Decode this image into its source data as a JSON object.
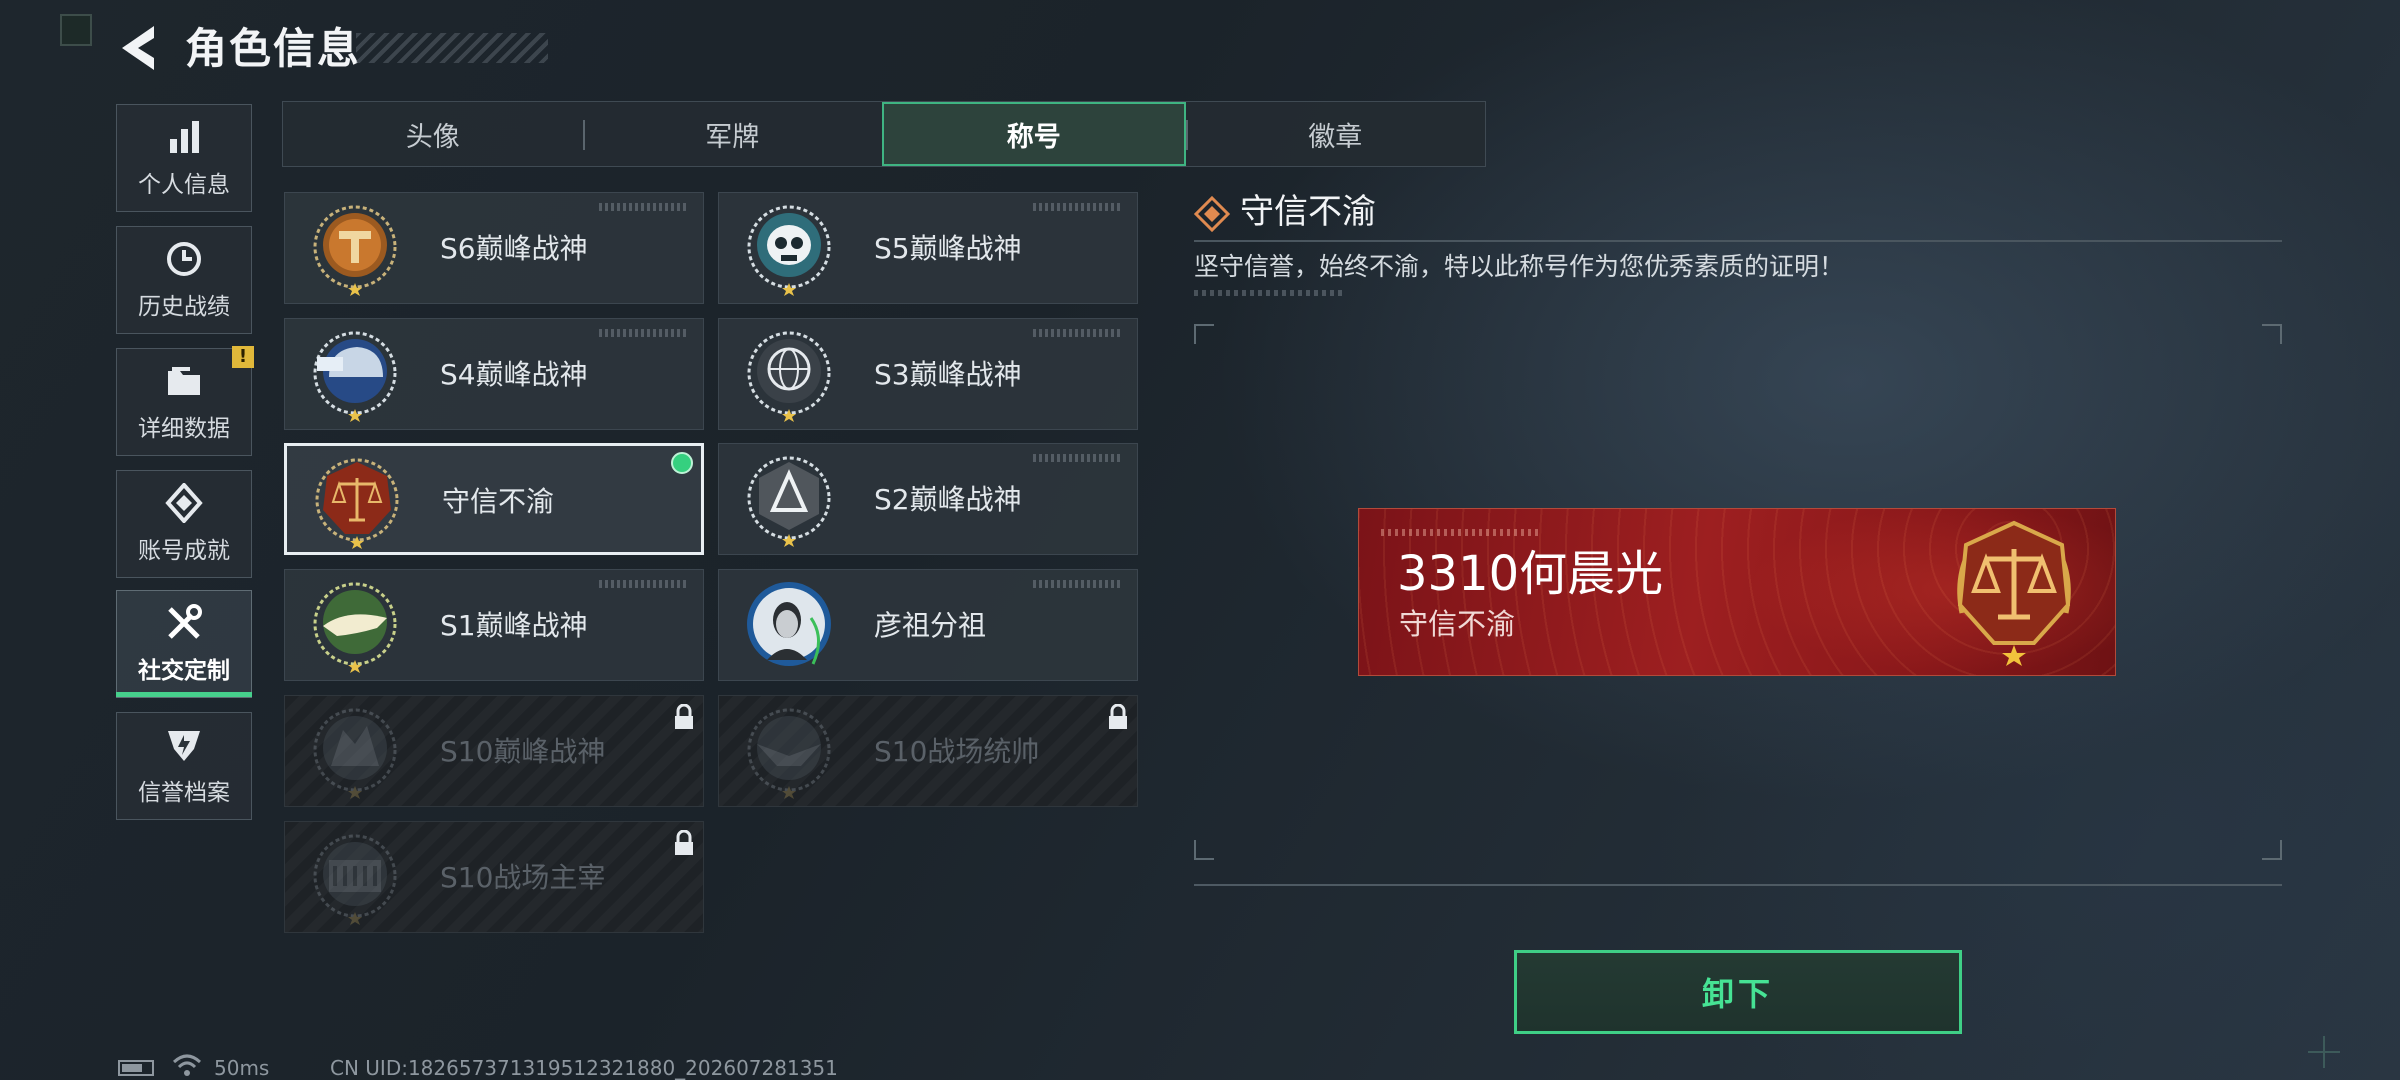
{
  "header": {
    "title": "角色信息"
  },
  "nav": {
    "items": [
      {
        "label": "个人信息",
        "icon": "bar-chart-icon"
      },
      {
        "label": "历史战绩",
        "icon": "clock-icon"
      },
      {
        "label": "详细数据",
        "icon": "folder-icon",
        "badge": "!"
      },
      {
        "label": "账号成就",
        "icon": "achievement-icon"
      },
      {
        "label": "社交定制",
        "icon": "tools-icon",
        "active": true
      },
      {
        "label": "信誉档案",
        "icon": "shield-badge-icon"
      }
    ]
  },
  "tabs": [
    {
      "label": "头像"
    },
    {
      "label": "军牌"
    },
    {
      "label": "称号",
      "active": true
    },
    {
      "label": "徽章"
    }
  ],
  "titles": [
    {
      "label": "S6巅峰战神",
      "emblem": "s6-emblem-icon"
    },
    {
      "label": "S5巅峰战神",
      "emblem": "s5-skull-emblem-icon"
    },
    {
      "label": "S4巅峰战神",
      "emblem": "s4-helmet-emblem-icon"
    },
    {
      "label": "S3巅峰战神",
      "emblem": "s3-globe-emblem-icon"
    },
    {
      "label": "守信不渝",
      "emblem": "scales-emblem-icon",
      "selected": true,
      "equipped": true
    },
    {
      "label": "S2巅峰战神",
      "emblem": "s2-emblem-icon"
    },
    {
      "label": "S1巅峰战神",
      "emblem": "s1-crocodile-emblem-icon"
    },
    {
      "label": "彦祖分祖",
      "emblem": "portrait-emblem-icon"
    },
    {
      "label": "S10巅峰战神",
      "emblem": "s10-emblem-icon",
      "locked": true
    },
    {
      "label": "S10战场统帅",
      "emblem": "s10-eagle-emblem-icon",
      "locked": true
    },
    {
      "label": "S10战场主宰",
      "emblem": "s10-colosseum-emblem-icon",
      "locked": true
    }
  ],
  "detail": {
    "title": "守信不渝",
    "description": "坚守信誉，始终不渝，特以此称号作为您优秀素质的证明！",
    "plate_name": "3310何晨光",
    "plate_title": "守信不渝",
    "button": "卸下"
  },
  "status": {
    "ping": "50ms",
    "uid": "CN UID:1826573713195123218​80_202607281351"
  },
  "colors": {
    "accent": "#3fcf86",
    "plate_red": "#9d1f20",
    "badge_yellow": "#e0b83a"
  }
}
